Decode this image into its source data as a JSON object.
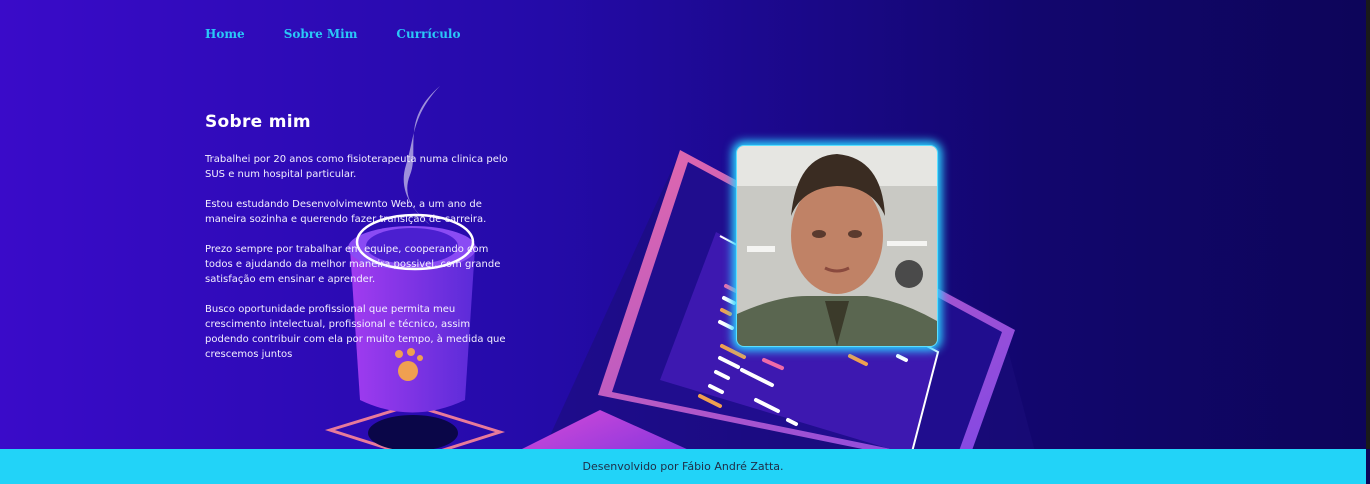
{
  "nav": {
    "items": [
      {
        "label": "Home"
      },
      {
        "label": "Sobre Mim"
      },
      {
        "label": "Currículo"
      }
    ]
  },
  "about": {
    "title": "Sobre mim",
    "paragraphs": [
      "Trabalhei por 20 anos como fisioterapeuta numa clinica pelo SUS e num hospital particular.",
      "Estou estudando Desenvolvimewnto Web, a um ano de maneira sozinha e querendo fazer transição de carreira.",
      "Prezo sempre por trabalhar em equipe, cooperando com todos e ajudando da melhor maneira possivel, com grande satisfação em ensinar e aprender.",
      "Busco oportunidade profissional que permita meu crescimento intelectual, profissional e técnico, assim podendo contribuir com ela por muito tempo, à medida que crescemos juntos"
    ]
  },
  "footer": {
    "text": "Desenvolvido por Fábio André Zatta."
  },
  "colors": {
    "nav_link": "#2ac8f7",
    "footer_bg": "#22d3f8",
    "photo_glow": "#2ad2ff"
  }
}
